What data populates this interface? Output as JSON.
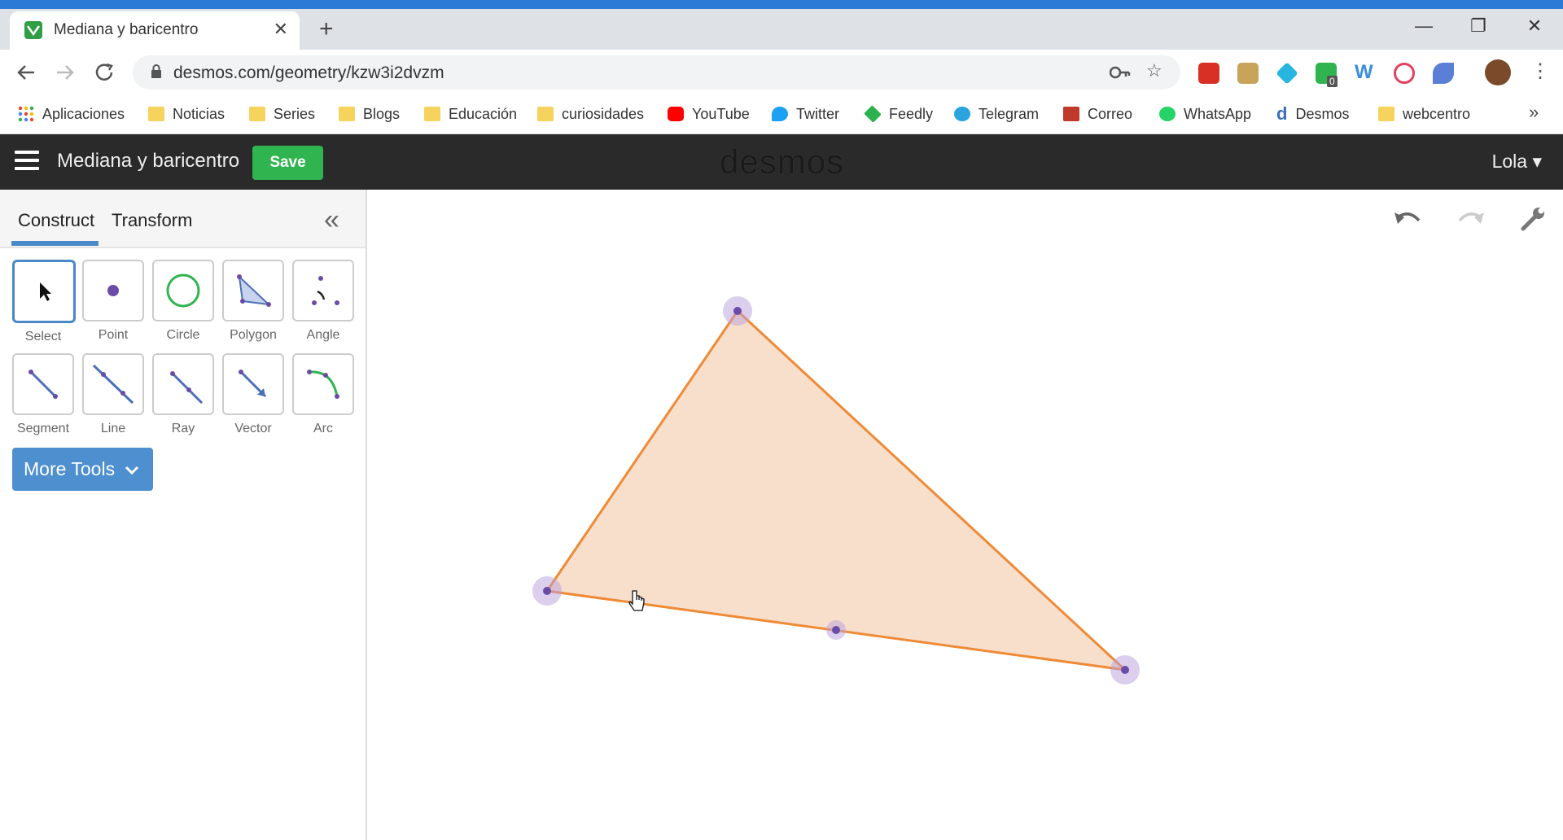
{
  "browser": {
    "tab_title": "Mediana y baricentro",
    "tab_close": "✕",
    "new_tab": "+",
    "window_controls": [
      "—",
      "❐",
      "✕"
    ],
    "url": "desmos.com/geometry/kzw3i2dvzm",
    "extension_badge": "0"
  },
  "bookmarks": [
    {
      "label": "Aplicaciones",
      "icon": "apps-grid-icon"
    },
    {
      "label": "Noticias",
      "icon": "folder-icon"
    },
    {
      "label": "Series",
      "icon": "folder-icon"
    },
    {
      "label": "Blogs",
      "icon": "folder-icon"
    },
    {
      "label": "Educación",
      "icon": "folder-icon"
    },
    {
      "label": "curiosidades",
      "icon": "folder-icon"
    },
    {
      "label": "YouTube",
      "icon": "youtube-icon",
      "color": "#ff0000"
    },
    {
      "label": "Twitter",
      "icon": "twitter-icon",
      "color": "#1da1f2"
    },
    {
      "label": "Feedly",
      "icon": "feedly-icon",
      "color": "#2bb24c"
    },
    {
      "label": "Telegram",
      "icon": "telegram-icon",
      "color": "#2aa3de"
    },
    {
      "label": "Correo",
      "icon": "mail-icon",
      "color": "#c0392b"
    },
    {
      "label": "WhatsApp",
      "icon": "whatsapp-icon",
      "color": "#25d366"
    },
    {
      "label": "Desmos",
      "icon": "desmos-icon",
      "color": "#3a6fb7"
    },
    {
      "label": "webcentro",
      "icon": "folder-icon"
    }
  ],
  "bookmarks_more": "»",
  "app": {
    "title": "Mediana y baricentro",
    "save_label": "Save",
    "logo": "desmos",
    "user": "Lola ▾"
  },
  "panel": {
    "tabs": [
      "Construct",
      "Transform"
    ],
    "active_tab": "Construct",
    "collapse": "«",
    "tools": [
      "Select",
      "Point",
      "Circle",
      "Polygon",
      "Angle",
      "Segment",
      "Line",
      "Ray",
      "Vector",
      "Arc"
    ],
    "active_tool": "Select",
    "more_tools": "More Tools"
  },
  "canvas": {
    "undo": "↶",
    "redo": "↷",
    "settings": "wrench-icon"
  },
  "colors": {
    "accent": "#4a89c8",
    "save_green": "#2fb44f",
    "polygon_stroke": "#ef8a36",
    "polygon_fill": "#f7d9c2",
    "point": "#6a4ca8",
    "header": "#2a2a2a"
  }
}
